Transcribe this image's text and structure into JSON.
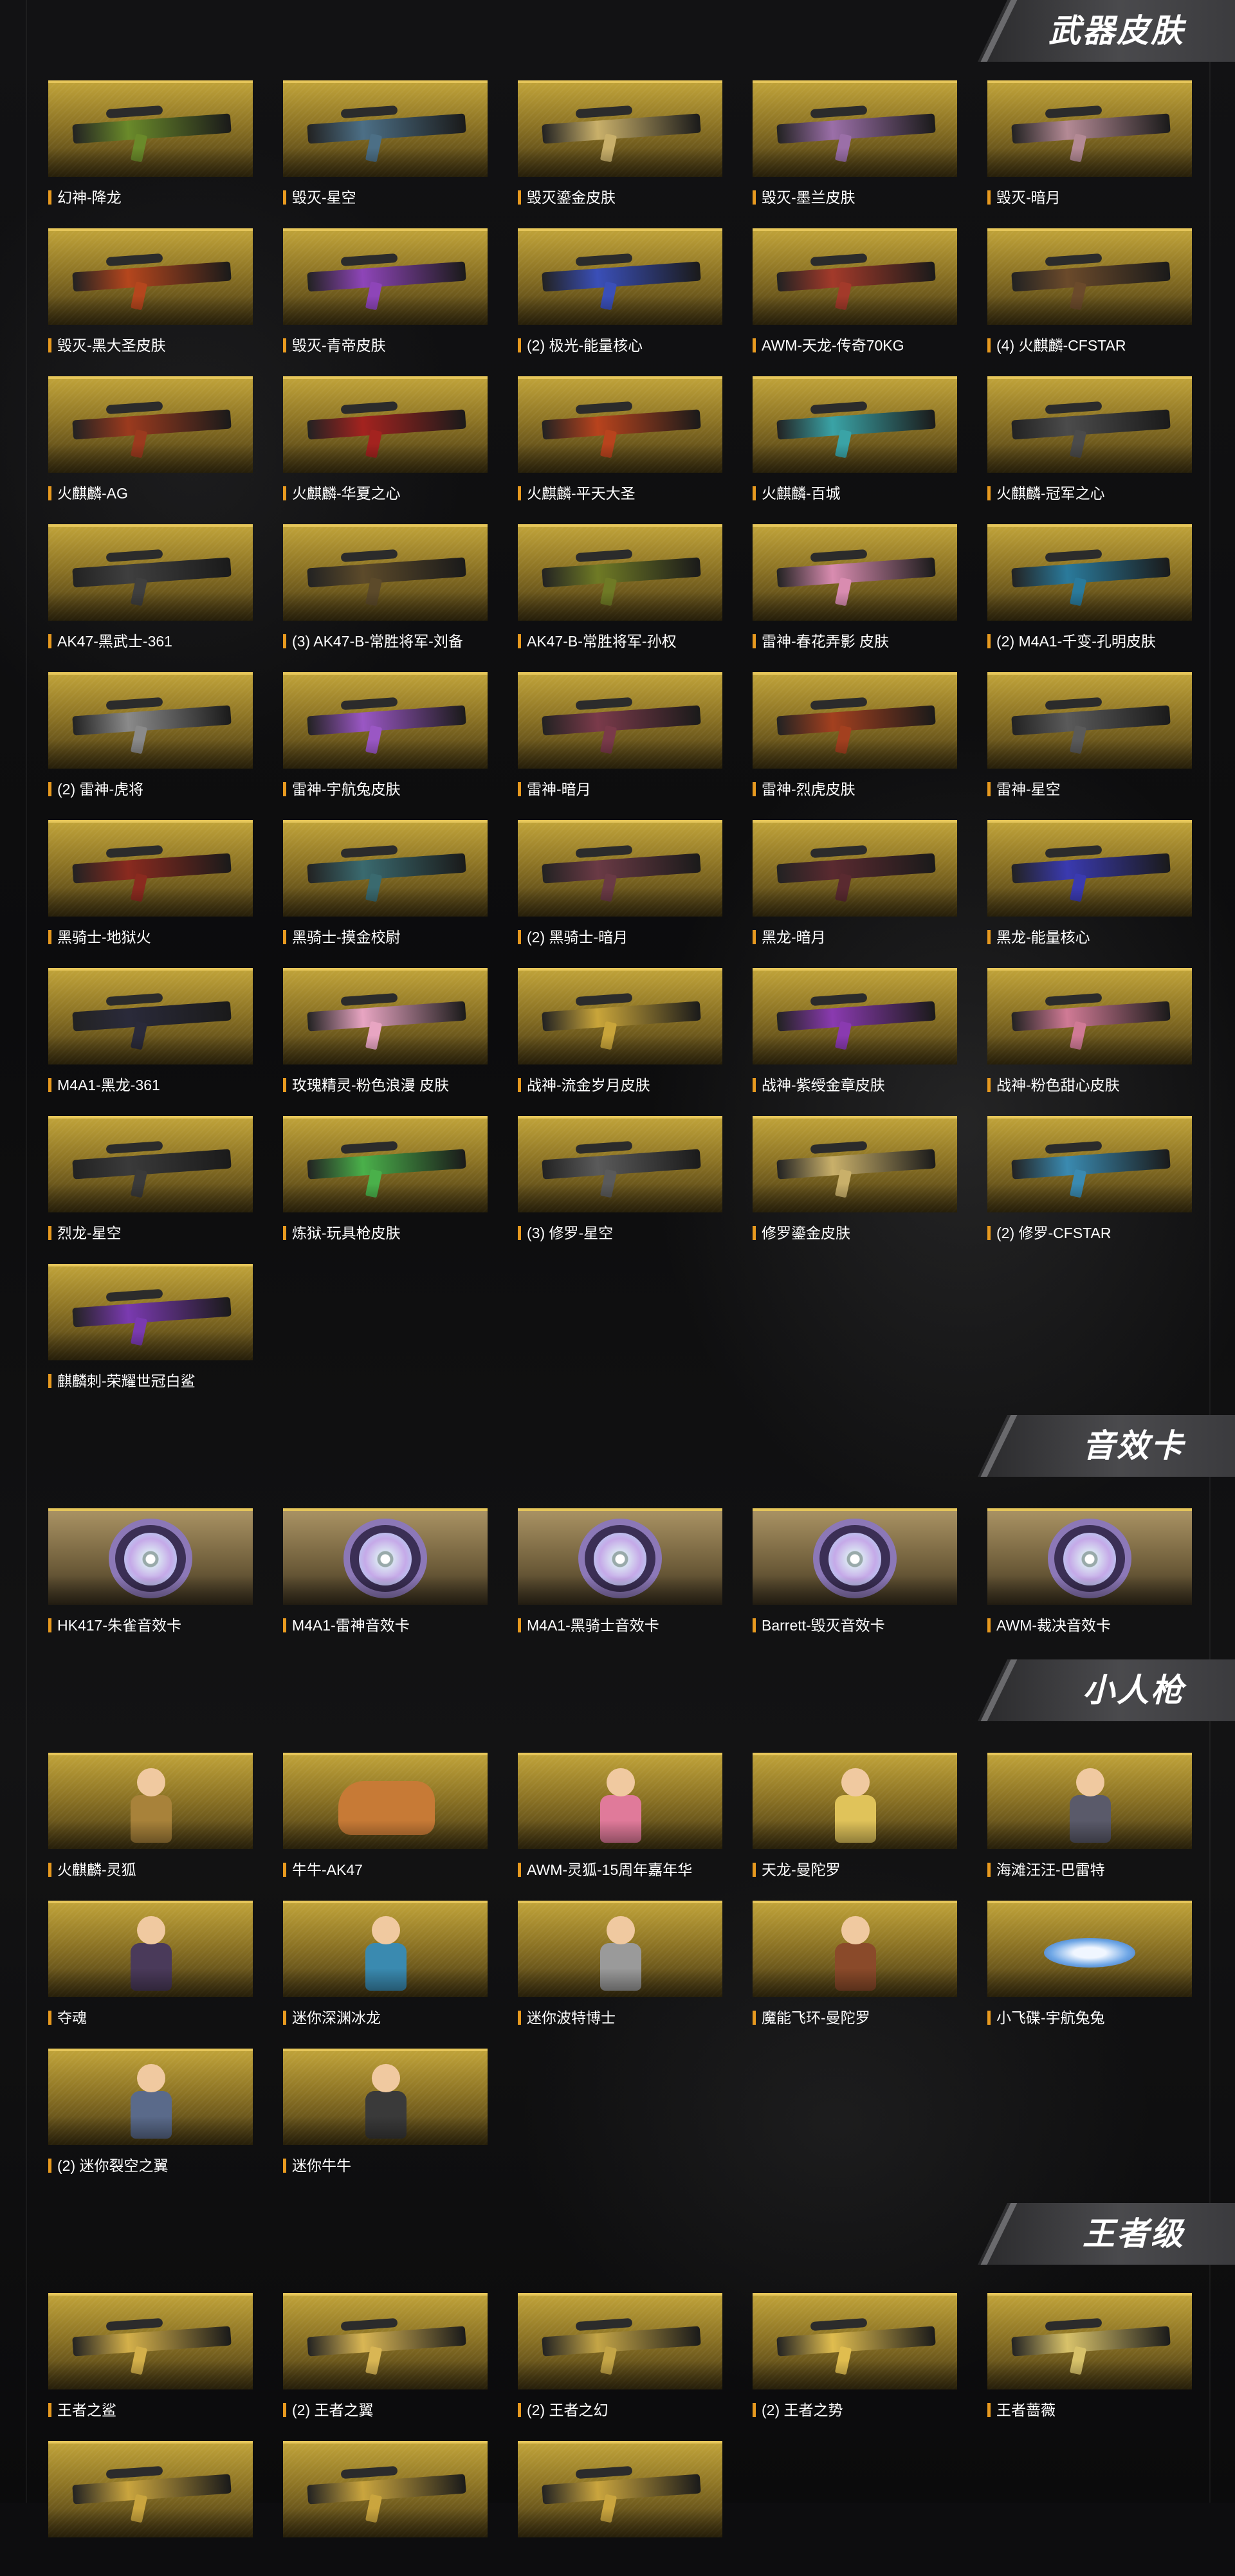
{
  "sections": [
    {
      "title": "武器皮肤",
      "items": [
        {
          "label": "幻神-降龙",
          "color": "#6a8a2a"
        },
        {
          "label": "毁灭-星空",
          "color": "#4c6f86"
        },
        {
          "label": "毁灭鎏金皮肤",
          "color": "#c9b06a"
        },
        {
          "label": "毁灭-墨兰皮肤",
          "color": "#9b6fa8"
        },
        {
          "label": "毁灭-暗月",
          "color": "#b48a95"
        },
        {
          "label": "毁灭-黑大圣皮肤",
          "color": "#b5461d"
        },
        {
          "label": "毁灭-青帝皮肤",
          "color": "#8e45b8"
        },
        {
          "label": "(2) 极光-能量核心",
          "color": "#3a4fb8"
        },
        {
          "label": "AWM-天龙-传奇70KG",
          "color": "#a33a2a"
        },
        {
          "label": "(4) 火麒麟-CFSTAR",
          "color": "#6b4a2b"
        },
        {
          "label": "火麒麟-AG",
          "color": "#9b3a1e"
        },
        {
          "label": "火麒麟-华夏之心",
          "color": "#a3231f"
        },
        {
          "label": "火麒麟-平天大圣",
          "color": "#b8431d"
        },
        {
          "label": "火麒麟-百城",
          "color": "#3aa3a6"
        },
        {
          "label": "火麒麟-冠军之心",
          "color": "#4b4b4b"
        },
        {
          "label": "AK47-黑武士-361",
          "color": "#3f3f3f"
        },
        {
          "label": "(3) AK47-B-常胜将军-刘备",
          "color": "#5c4a2a"
        },
        {
          "label": "AK47-B-常胜将军-孙权",
          "color": "#6f7a25"
        },
        {
          "label": "雷神-春花弄影 皮肤",
          "color": "#d98cb0"
        },
        {
          "label": "(2) M4A1-千变-孔明皮肤",
          "color": "#2a7a9b"
        },
        {
          "label": "(2) 雷神-虎将",
          "color": "#8a8a8a"
        },
        {
          "label": "雷神-宇航兔皮肤",
          "color": "#9a57c4"
        },
        {
          "label": "雷神-暗月",
          "color": "#7a3a4a"
        },
        {
          "label": "雷神-烈虎皮肤",
          "color": "#a3401f"
        },
        {
          "label": "雷神-星空",
          "color": "#5a5a5a"
        },
        {
          "label": "黑骑士-地狱火",
          "color": "#8a2a1f"
        },
        {
          "label": "黑骑士-摸金校尉",
          "color": "#3a6a6f"
        },
        {
          "label": "(2) 黑骑士-暗月",
          "color": "#6a3a45"
        },
        {
          "label": "黑龙-暗月",
          "color": "#5a2a30"
        },
        {
          "label": "黑龙-能量核心",
          "color": "#3a3ab0"
        },
        {
          "label": "M4A1-黑龙-361",
          "color": "#2a2a3a"
        },
        {
          "label": "玫瑰精灵-粉色浪漫 皮肤",
          "color": "#e8a5c2"
        },
        {
          "label": "战神-流金岁月皮肤",
          "color": "#c9a53a"
        },
        {
          "label": "战神-紫绶金章皮肤",
          "color": "#8a3ab0"
        },
        {
          "label": "战神-粉色甜心皮肤",
          "color": "#d07a95"
        },
        {
          "label": "烈龙-星空",
          "color": "#3a3a3a"
        },
        {
          "label": "炼狱-玩具枪皮肤",
          "color": "#4ab04a"
        },
        {
          "label": "(3) 修罗-星空",
          "color": "#5a5a5a"
        },
        {
          "label": "修罗鎏金皮肤",
          "color": "#c9b06a"
        },
        {
          "label": "(2) 修罗-CFSTAR",
          "color": "#3a8ab0"
        },
        {
          "label": "麒麟刺-荣耀世冠白鲨",
          "color": "#7a3ab0"
        }
      ]
    },
    {
      "title": "音效卡",
      "items": [
        {
          "label": "HK417-朱雀音效卡",
          "color": "#b7b7e0"
        },
        {
          "label": "M4A1-雷神音效卡",
          "color": "#b7b7e0"
        },
        {
          "label": "M4A1-黑骑士音效卡",
          "color": "#b7b7e0"
        },
        {
          "label": "Barrett-毁灭音效卡",
          "color": "#b7b7e0"
        },
        {
          "label": "AWM-裁决音效卡",
          "color": "#b7b7e0"
        }
      ]
    },
    {
      "title": "小人枪",
      "items": [
        {
          "label": "火麒麟-灵狐",
          "color": "#a8823a"
        },
        {
          "label": "牛牛-AK47",
          "color": "#c77a36"
        },
        {
          "label": "AWM-灵狐-15周年嘉年华",
          "color": "#e07a9a"
        },
        {
          "label": "天龙-曼陀罗",
          "color": "#e0c35a"
        },
        {
          "label": "海滩汪汪-巴雷特",
          "color": "#5a5a6a"
        },
        {
          "label": "夺魂",
          "color": "#4a3a5a"
        },
        {
          "label": "迷你深渊冰龙",
          "color": "#3a8ab0"
        },
        {
          "label": "迷你波特博士",
          "color": "#9a9a9a"
        },
        {
          "label": "魔能飞环-曼陀罗",
          "color": "#8a4a2a"
        },
        {
          "label": "小飞碟-宇航兔兔",
          "color": "#6fa7e6"
        },
        {
          "label": "(2) 迷你裂空之翼",
          "color": "#5a6a8a"
        },
        {
          "label": "迷你牛牛",
          "color": "#3a3a3a"
        }
      ]
    },
    {
      "title": "王者级",
      "items": [
        {
          "label": "王者之鲨",
          "color": "#d4b04a"
        },
        {
          "label": "(2) 王者之翼",
          "color": "#d9b654"
        },
        {
          "label": "(2) 王者之幻",
          "color": "#c4a546"
        },
        {
          "label": "(2) 王者之势",
          "color": "#e0bd4f"
        },
        {
          "label": "王者蔷薇",
          "color": "#d8c26a"
        },
        {
          "label": "",
          "color": "#caa53e"
        },
        {
          "label": "",
          "color": "#caa53e"
        },
        {
          "label": "",
          "color": "#caa53e"
        }
      ]
    }
  ]
}
